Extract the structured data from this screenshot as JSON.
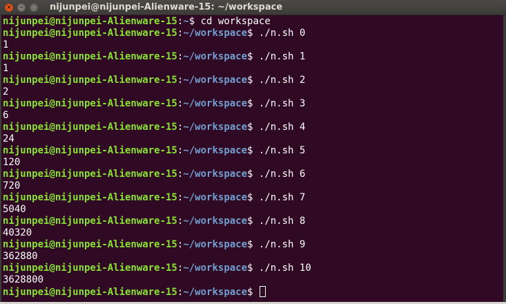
{
  "window": {
    "title": "nijunpei@nijunpei-Alienware-15: ~/workspace",
    "buttons": {
      "close": "×",
      "minimize": "–",
      "maximize": "□"
    }
  },
  "terminal": {
    "colors": {
      "background": "#300a24",
      "user": "#8ae234",
      "path": "#729fcf",
      "text": "#ffffff"
    },
    "lines": [
      {
        "type": "prompt",
        "user": "nijunpei@nijunpei-Alienware-15",
        "path": "~",
        "command": "cd workspace"
      },
      {
        "type": "prompt",
        "user": "nijunpei@nijunpei-Alienware-15",
        "path": "~/workspace",
        "command": "./n.sh 0"
      },
      {
        "type": "output",
        "text": "1"
      },
      {
        "type": "prompt",
        "user": "nijunpei@nijunpei-Alienware-15",
        "path": "~/workspace",
        "command": "./n.sh 1"
      },
      {
        "type": "output",
        "text": "1"
      },
      {
        "type": "prompt",
        "user": "nijunpei@nijunpei-Alienware-15",
        "path": "~/workspace",
        "command": "./n.sh 2"
      },
      {
        "type": "output",
        "text": "2"
      },
      {
        "type": "prompt",
        "user": "nijunpei@nijunpei-Alienware-15",
        "path": "~/workspace",
        "command": "./n.sh 3"
      },
      {
        "type": "output",
        "text": "6"
      },
      {
        "type": "prompt",
        "user": "nijunpei@nijunpei-Alienware-15",
        "path": "~/workspace",
        "command": "./n.sh 4"
      },
      {
        "type": "output",
        "text": "24"
      },
      {
        "type": "prompt",
        "user": "nijunpei@nijunpei-Alienware-15",
        "path": "~/workspace",
        "command": "./n.sh 5"
      },
      {
        "type": "output",
        "text": "120"
      },
      {
        "type": "prompt",
        "user": "nijunpei@nijunpei-Alienware-15",
        "path": "~/workspace",
        "command": "./n.sh 6"
      },
      {
        "type": "output",
        "text": "720"
      },
      {
        "type": "prompt",
        "user": "nijunpei@nijunpei-Alienware-15",
        "path": "~/workspace",
        "command": "./n.sh 7"
      },
      {
        "type": "output",
        "text": "5040"
      },
      {
        "type": "prompt",
        "user": "nijunpei@nijunpei-Alienware-15",
        "path": "~/workspace",
        "command": "./n.sh 8"
      },
      {
        "type": "output",
        "text": "40320"
      },
      {
        "type": "prompt",
        "user": "nijunpei@nijunpei-Alienware-15",
        "path": "~/workspace",
        "command": "./n.sh 9"
      },
      {
        "type": "output",
        "text": "362880"
      },
      {
        "type": "prompt",
        "user": "nijunpei@nijunpei-Alienware-15",
        "path": "~/workspace",
        "command": "./n.sh 10"
      },
      {
        "type": "output",
        "text": "3628800"
      },
      {
        "type": "prompt",
        "user": "nijunpei@nijunpei-Alienware-15",
        "path": "~/workspace",
        "command": "",
        "cursor": true
      }
    ]
  }
}
